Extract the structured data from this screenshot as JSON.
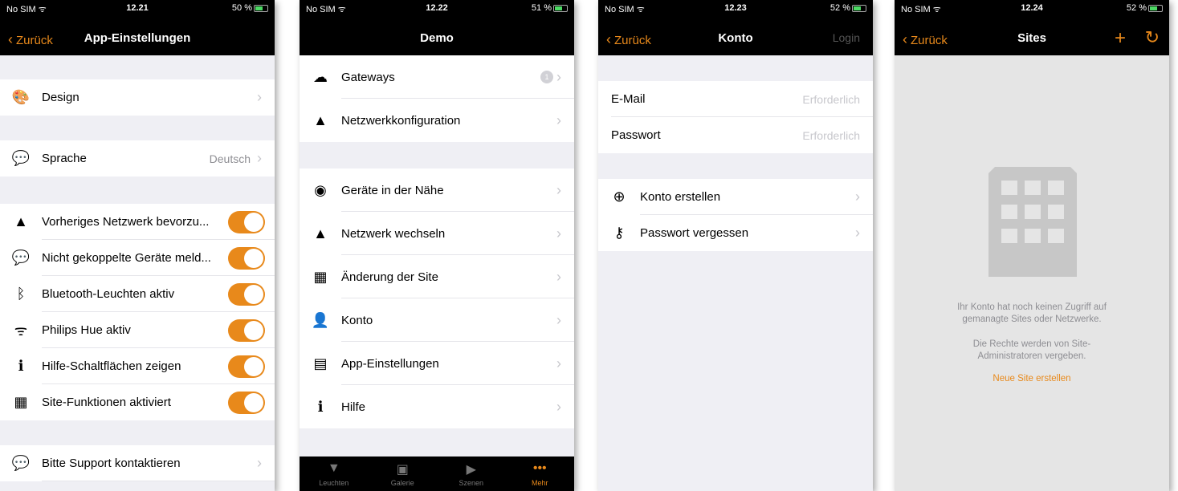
{
  "accent_color": "#e8891b",
  "screens": [
    {
      "status": {
        "carrier": "No SIM ᯤ",
        "time": "12.21",
        "battery": "50 %"
      },
      "nav": {
        "back": "Zurück",
        "title": "App-Einstellungen"
      },
      "rows": [
        {
          "icon": "paint-bucket-icon",
          "label": "Design"
        },
        {
          "icon": "speech-bubble-icon",
          "label": "Sprache",
          "value": "Deutsch"
        },
        {
          "icon": "location-arrow-icon",
          "label": "Vorheriges Netzwerk bevorzu..."
        },
        {
          "icon": "speech-bubble-icon",
          "label": "Nicht gekoppelte Geräte meld..."
        },
        {
          "icon": "bluetooth-icon",
          "label": "Bluetooth-Leuchten aktiv"
        },
        {
          "icon": "wifi-icon",
          "label": "Philips Hue aktiv"
        },
        {
          "icon": "info-icon",
          "label": "Hilfe-Schaltflächen zeigen"
        },
        {
          "icon": "building-icon",
          "label": "Site-Funktionen aktiviert"
        },
        {
          "icon": "speech-bubble-icon",
          "label": "Bitte Support kontaktieren"
        }
      ]
    },
    {
      "status": {
        "carrier": "No SIM ᯤ",
        "time": "12.22",
        "battery": "51 %"
      },
      "nav": {
        "title": "Demo"
      },
      "gateway_badge": "1",
      "rows": [
        {
          "icon": "cloud-upload-icon",
          "label": "Gateways"
        },
        {
          "icon": "location-arrow-icon",
          "label": "Netzwerkkonfiguration"
        },
        {
          "icon": "nearby-devices-icon",
          "label": "Geräte in der Nähe"
        },
        {
          "icon": "location-arrow-icon",
          "label": "Netzwerk wechseln"
        },
        {
          "icon": "building-icon",
          "label": "Änderung der Site"
        },
        {
          "icon": "user-icon",
          "label": "Konto"
        },
        {
          "icon": "sliders-icon",
          "label": "App-Einstellungen"
        },
        {
          "icon": "info-icon",
          "label": "Hilfe"
        }
      ],
      "tabs": [
        {
          "icon": "lamp-icon",
          "label": "Leuchten"
        },
        {
          "icon": "gallery-icon",
          "label": "Galerie"
        },
        {
          "icon": "scenes-icon",
          "label": "Szenen"
        },
        {
          "icon": "more-icon",
          "label": "Mehr"
        }
      ]
    },
    {
      "status": {
        "carrier": "No SIM ᯤ",
        "time": "12.23",
        "battery": "52 %"
      },
      "nav": {
        "back": "Zurück",
        "title": "Konto",
        "right": "Login"
      },
      "fields": [
        {
          "label": "E-Mail",
          "placeholder": "Erforderlich"
        },
        {
          "label": "Passwort",
          "placeholder": "Erforderlich"
        }
      ],
      "rows": [
        {
          "icon": "plus-circle-icon",
          "label": "Konto erstellen"
        },
        {
          "icon": "key-icon",
          "label": "Passwort vergessen"
        }
      ]
    },
    {
      "status": {
        "carrier": "No SIM ᯤ",
        "time": "12.24",
        "battery": "52 %"
      },
      "nav": {
        "back": "Zurück",
        "title": "Sites"
      },
      "empty": {
        "line1": "Ihr Konto hat noch keinen Zugriff auf",
        "line2": "gemanagte Sites oder Netzwerke.",
        "line3": "Die Rechte werden von Site-",
        "line4": "Administratoren vergeben.",
        "link": "Neue Site erstellen"
      }
    }
  ]
}
